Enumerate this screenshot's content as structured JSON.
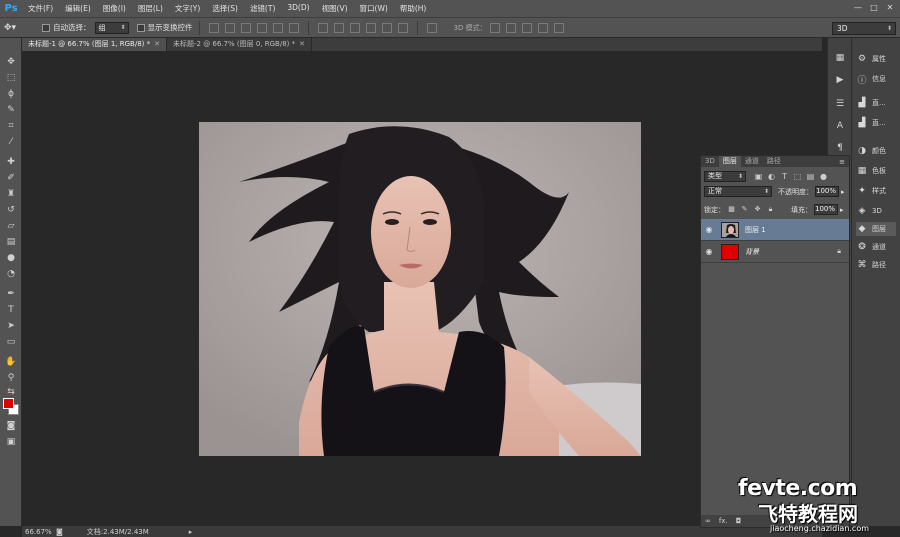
{
  "app": {
    "logo": "Ps"
  },
  "menu": [
    "文件(F)",
    "编辑(E)",
    "图像(I)",
    "图层(L)",
    "文字(Y)",
    "选择(S)",
    "滤镜(T)",
    "3D(D)",
    "视图(V)",
    "窗口(W)",
    "帮助(H)"
  ],
  "window_controls": [
    "—",
    "□",
    "✕"
  ],
  "options": {
    "auto_select_label": "自动选择：",
    "auto_select_value": "组",
    "show_transform_label": "显示变换控件",
    "mode3d_label": "3D 模式：",
    "workspace": "3D"
  },
  "tabs": [
    {
      "label": "未标题-1 @ 66.7% (图层 1, RGB/8) *",
      "active": true
    },
    {
      "label": "未标题-2 @ 66.7% (图层 0, RGB/8) *",
      "active": false
    }
  ],
  "status": {
    "zoom": "66.67%",
    "doc": "文档:2.43M/2.43M"
  },
  "right_panels": [
    {
      "label": "属性",
      "icon": "properties-icon"
    },
    {
      "label": "信息",
      "icon": "info-icon"
    },
    {
      "label": "直...",
      "icon": "histogram-icon"
    },
    {
      "label": "直...",
      "icon": "histogram-icon"
    },
    {
      "label": "颜色",
      "icon": "color-icon"
    },
    {
      "label": "色板",
      "icon": "swatches-icon"
    },
    {
      "label": "样式",
      "icon": "styles-icon"
    },
    {
      "label": "3D",
      "icon": "cube-icon"
    },
    {
      "label": "图层",
      "icon": "layers-icon"
    },
    {
      "label": "通道",
      "icon": "channels-icon"
    },
    {
      "label": "路径",
      "icon": "paths-icon"
    }
  ],
  "layers_panel": {
    "tabs": [
      "3D",
      "图层",
      "通道",
      "路径"
    ],
    "filter": "类型",
    "blend_mode": "正常",
    "opacity_label": "不透明度：",
    "opacity": "100%",
    "lock_label": "锁定：",
    "fill_label": "填充：",
    "fill": "100%",
    "layers": [
      {
        "name": "图层 1",
        "thumb": "photo",
        "selected": true
      },
      {
        "name": "背景",
        "thumb": "red",
        "selected": false,
        "locked": true
      }
    ],
    "bottom_icons": [
      "∞",
      "fx.",
      "◘"
    ]
  },
  "watermark": {
    "main": "fevte.com",
    "cn": "飞特教程网",
    "sub": "jiaocheng.chazidian.com"
  }
}
